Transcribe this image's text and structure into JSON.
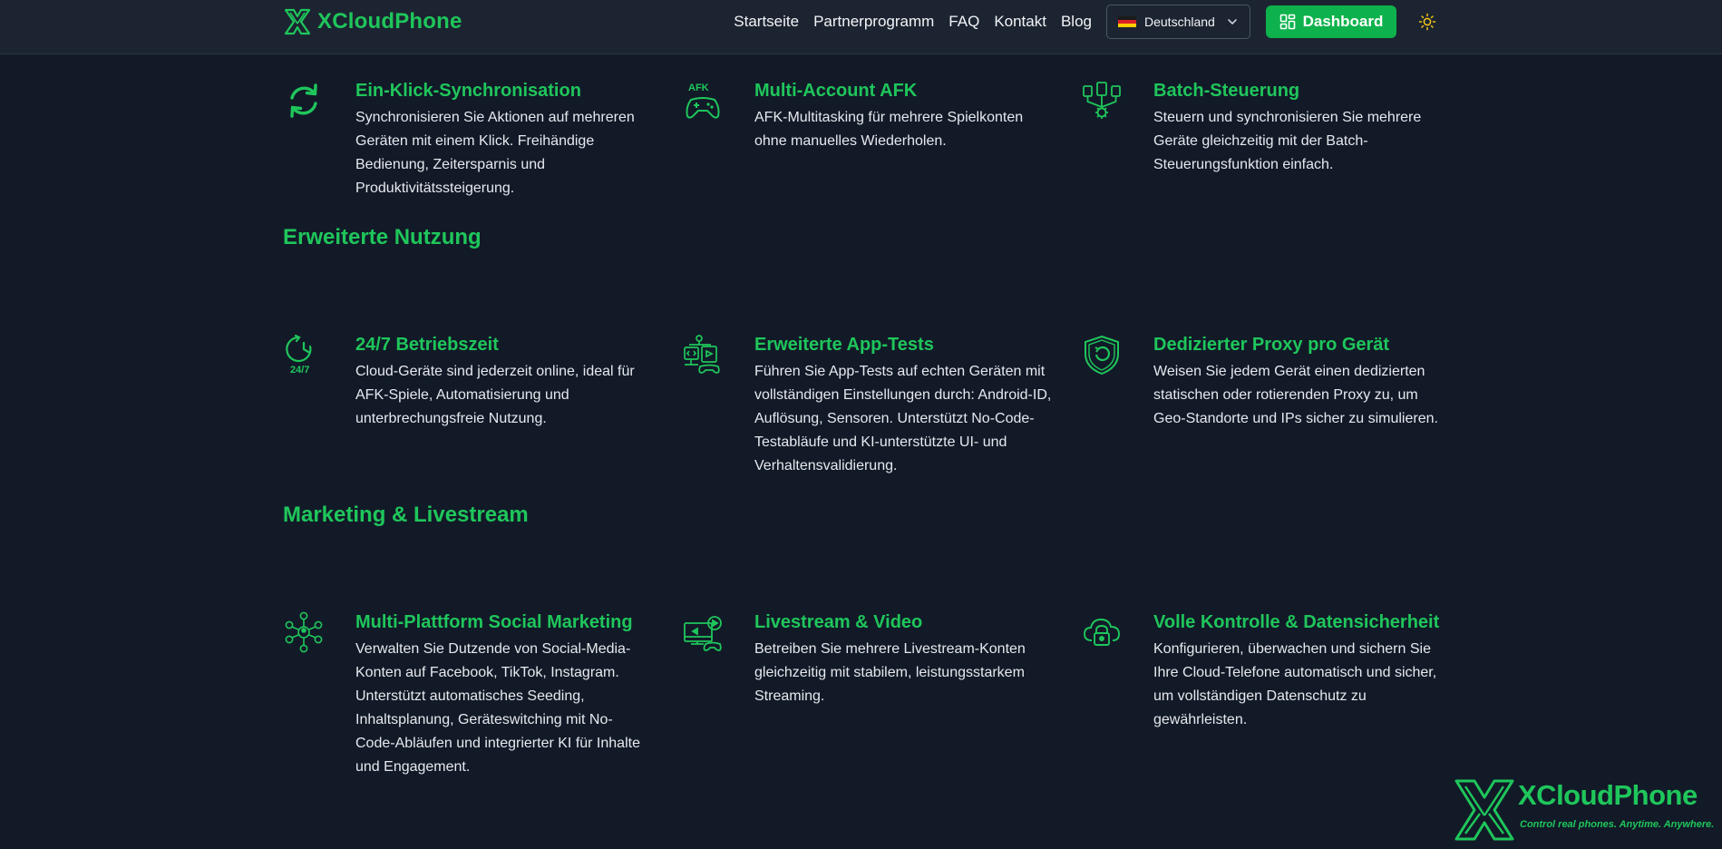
{
  "header": {
    "brand_name": "XCloudPhone",
    "nav": [
      "Startseite",
      "Partnerprogramm",
      "FAQ",
      "Kontakt",
      "Blog"
    ],
    "language": "Deutschland",
    "dashboard_label": "Dashboard"
  },
  "colors": {
    "accent": "#1fc65b",
    "button": "#0eb24c",
    "background": "#121a28",
    "header": "#1c2431"
  },
  "top_features": [
    {
      "icon": "sync-icon",
      "title": "Ein-Klick-Synchronisation",
      "desc": "Synchronisieren Sie Aktionen auf mehreren Geräten mit einem Klick. Freihändige Bedienung, Zeitersparnis und Produktivitätssteigerung."
    },
    {
      "icon": "afk-gamepad-icon",
      "title": "Multi-Account AFK",
      "desc": "AFK-Multitasking für mehrere Spielkonten ohne manuelles Wiederholen."
    },
    {
      "icon": "batch-control-icon",
      "title": "Batch-Steuerung",
      "desc": "Steuern und synchronisieren Sie mehrere Geräte gleichzeitig mit der Batch-Steuerungsfunktion einfach."
    }
  ],
  "sections": [
    {
      "title": "Erweiterte Nutzung",
      "features": [
        {
          "icon": "clock-24-7-icon",
          "title": "24/7 Betriebszeit",
          "desc": "Cloud-Geräte sind jederzeit online, ideal für AFK-Spiele, Automatisierung und unterbrechungsfreie Nutzung."
        },
        {
          "icon": "app-testing-icon",
          "title": "Erweiterte App-Tests",
          "desc": "Führen Sie App-Tests auf echten Geräten mit vollständigen Einstellungen durch: Android-ID, Auflösung, Sensoren. Unterstützt No-Code-Testabläufe und KI-unterstützte UI- und Verhaltensvalidierung."
        },
        {
          "icon": "shield-proxy-icon",
          "title": "Dedizierter Proxy pro Gerät",
          "desc": "Weisen Sie jedem Gerät einen dedizierten statischen oder rotierenden Proxy zu, um Geo-Standorte und IPs sicher zu simulieren."
        }
      ]
    },
    {
      "title": "Marketing & Livestream",
      "features": [
        {
          "icon": "social-network-icon",
          "title": "Multi-Plattform Social Marketing",
          "desc": "Verwalten Sie Dutzende von Social-Media-Konten auf Facebook, TikTok, Instagram. Unterstützt automatisches Seeding, Inhaltsplanung, Geräteswitching mit No-Code-Abläufen und integrierter KI für Inhalte und Engagement."
        },
        {
          "icon": "livestream-icon",
          "title": "Livestream & Video",
          "desc": "Betreiben Sie mehrere Livestream-Konten gleichzeitig mit stabilem, leistungsstarkem Streaming."
        },
        {
          "icon": "cloud-lock-icon",
          "title": "Volle Kontrolle & Datensicherheit",
          "desc": "Konfigurieren, überwachen und sichern Sie Ihre Cloud-Telefone automatisch und sicher, um vollständigen Datenschutz zu gewährleisten."
        }
      ]
    }
  ],
  "watermark": {
    "name": "XCloudPhone",
    "tagline": "Control real phones. Anytime. Anywhere."
  }
}
